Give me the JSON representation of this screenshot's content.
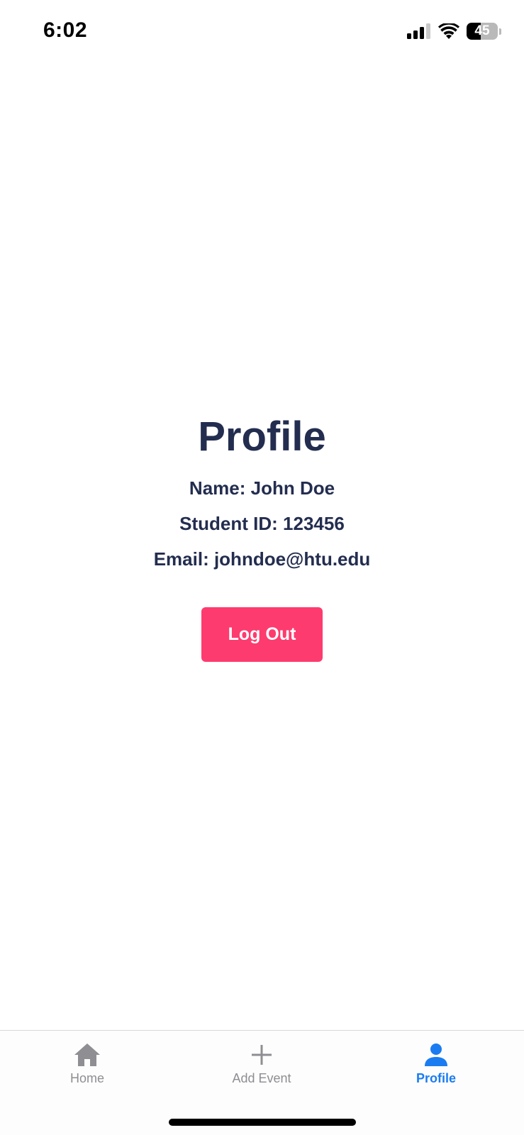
{
  "status_bar": {
    "time": "6:02",
    "battery_level": "45",
    "battery_fraction": 0.45,
    "icons": [
      "cellular-signal-icon",
      "wifi-icon",
      "battery-icon"
    ]
  },
  "profile": {
    "title": "Profile",
    "name_line": "Name: John Doe",
    "student_id_line": "Student ID: 123456",
    "email_line": "Email: johndoe@htu.edu",
    "logout_label": "Log Out"
  },
  "tab_bar": {
    "tabs": [
      {
        "label": "Home",
        "icon": "home-icon",
        "active": false
      },
      {
        "label": "Add Event",
        "icon": "plus-icon",
        "active": false
      },
      {
        "label": "Profile",
        "icon": "person-icon",
        "active": true
      }
    ]
  },
  "colors": {
    "text_primary": "#232d4f",
    "logout_button": "#fe3b6e",
    "tab_active": "#1b7cf2",
    "tab_inactive": "#8e8e93"
  }
}
